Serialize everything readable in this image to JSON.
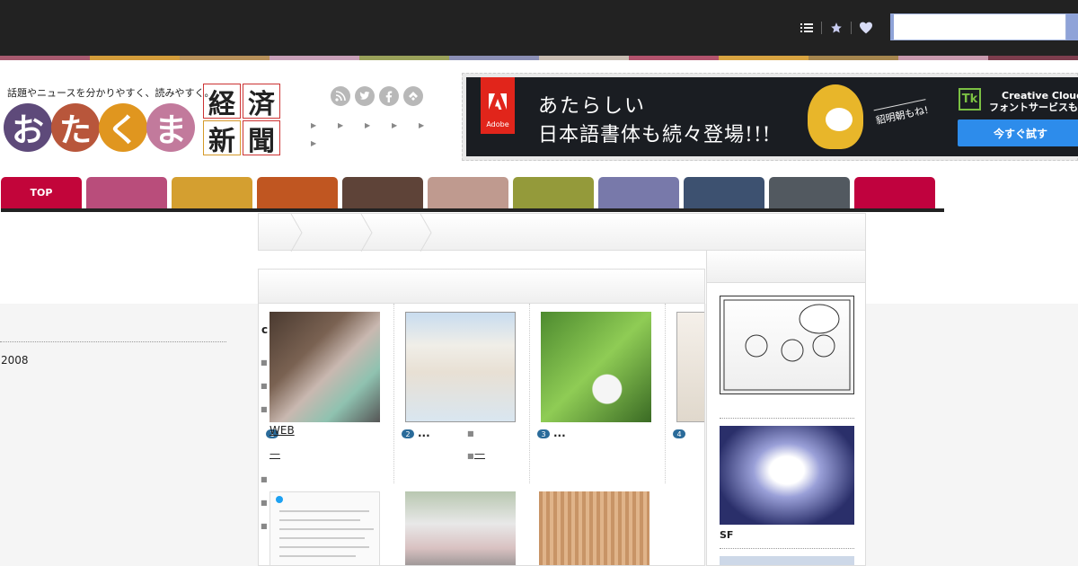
{
  "header": {
    "icons": [
      "list-icon",
      "star-icon",
      "heart-icon"
    ],
    "search_placeholder": ""
  },
  "stripe_colors": [
    "#a85a6f",
    "#d39c3a",
    "#b7905a",
    "#c8a0b8",
    "#9aa15a",
    "#8b8fb5",
    "#c9bdb2",
    "#b3536d",
    "#d9a441",
    "#a6864e",
    "#c99aae",
    "#7d3d4d"
  ],
  "logo": {
    "tagline": "話題やニュースを分かりやすく、読みやすく。",
    "kana": [
      {
        "char": "お",
        "color": "#5e4a7a"
      },
      {
        "char": "た",
        "color": "#b8563b"
      },
      {
        "char": "く",
        "color": "#e0961f"
      },
      {
        "char": "ま",
        "color": "#c27a9c"
      }
    ],
    "kanji": [
      "経",
      "済",
      "新",
      "聞"
    ]
  },
  "social": [
    "rss-icon",
    "twitter-icon",
    "facebook-icon",
    "feedly-icon"
  ],
  "ad": {
    "brand": "Adobe",
    "line1": "あたらしい",
    "line2": "日本語書体も続々登場!!!",
    "font_name": "貂明朝もね!",
    "service_1": "Creative Cloud な",
    "service_2": "フォントサービスも",
    "cta": "今すぐ試す",
    "tk": "Tk"
  },
  "nav": {
    "tabs": [
      {
        "label": "TOP",
        "color": "#c2053a"
      },
      {
        "label": "",
        "color": "#b94d7b"
      },
      {
        "label": "",
        "color": "#d49f30"
      },
      {
        "label": "",
        "color": "#c05621"
      },
      {
        "label": "",
        "color": "#5e4338"
      },
      {
        "label": "",
        "color": "#bf9a8f"
      },
      {
        "label": "",
        "color": "#949a3a"
      },
      {
        "label": "",
        "color": "#7879aa"
      },
      {
        "label": "",
        "color": "#3d5170"
      },
      {
        "label": "",
        "color": "#525960"
      },
      {
        "label": "",
        "color": "#c0023e"
      }
    ]
  },
  "content": {
    "letter": "c",
    "year": "2008",
    "web": "WEB",
    "dash": "—",
    "ranking": [
      {
        "rank": "1",
        "title": ""
      },
      {
        "rank": "2",
        "title": "..."
      },
      {
        "rank": "3",
        "title": "..."
      },
      {
        "rank": "4",
        "title": ""
      }
    ]
  },
  "sidebar": {
    "label": "SF"
  }
}
